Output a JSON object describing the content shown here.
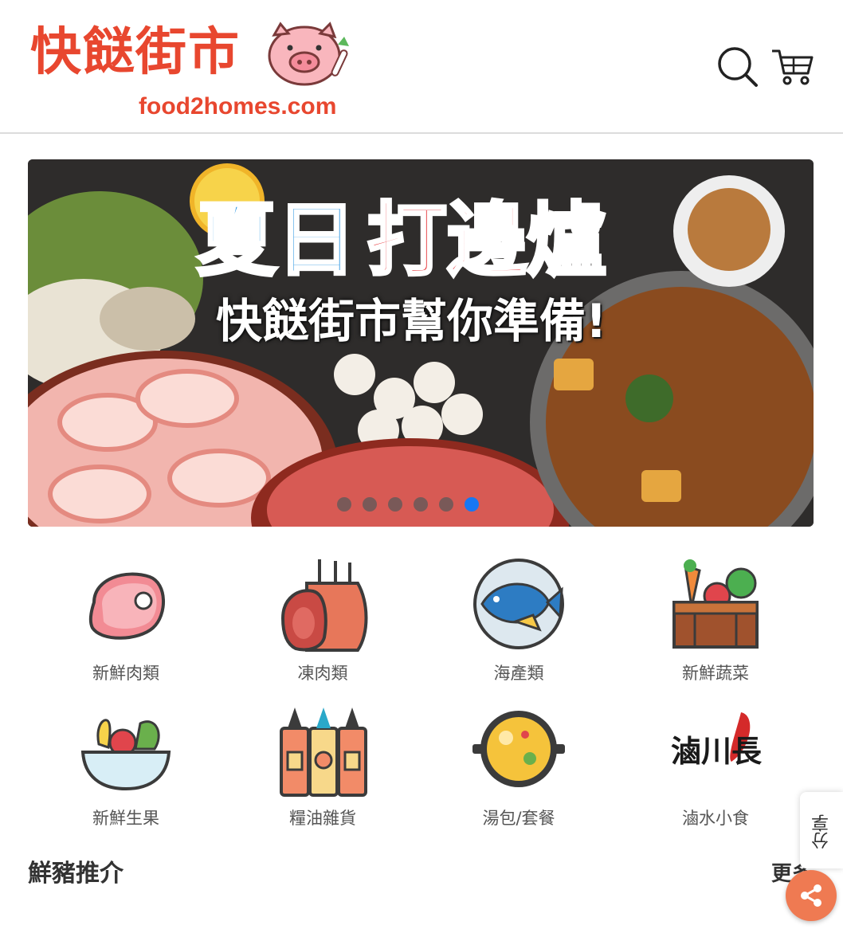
{
  "header": {
    "logo_title": "快餸街市",
    "logo_subtitle": "food2homes.com",
    "search_icon": "search-icon",
    "cart_icon": "cart-icon"
  },
  "banner": {
    "headline_part1": "夏日",
    "headline_part2": "打邊爐",
    "subline": "快餸街市幫你準備!",
    "slide_count": 6,
    "active_slide": 6
  },
  "categories": [
    {
      "label": "新鮮肉類",
      "icon": "fresh-meat-icon"
    },
    {
      "label": "凍肉類",
      "icon": "frozen-meat-icon"
    },
    {
      "label": "海產類",
      "icon": "seafood-icon"
    },
    {
      "label": "新鮮蔬菜",
      "icon": "vegetables-icon"
    },
    {
      "label": "新鮮生果",
      "icon": "fruit-bowl-icon"
    },
    {
      "label": "糧油雜貨",
      "icon": "condiments-icon"
    },
    {
      "label": "湯包/套餐",
      "icon": "soup-pot-icon"
    },
    {
      "label": "滷水小食",
      "icon": "braised-snacks-logo",
      "logo_text": "滷川長"
    }
  ],
  "section": {
    "title": "鮮豬推介",
    "more_label": "更多"
  },
  "share": {
    "tab_label": "分享",
    "fab_icon": "share-icon"
  },
  "colors": {
    "brand": "#e8472f",
    "accent_blue": "#1877f2",
    "share_orange": "#ef7a52"
  }
}
